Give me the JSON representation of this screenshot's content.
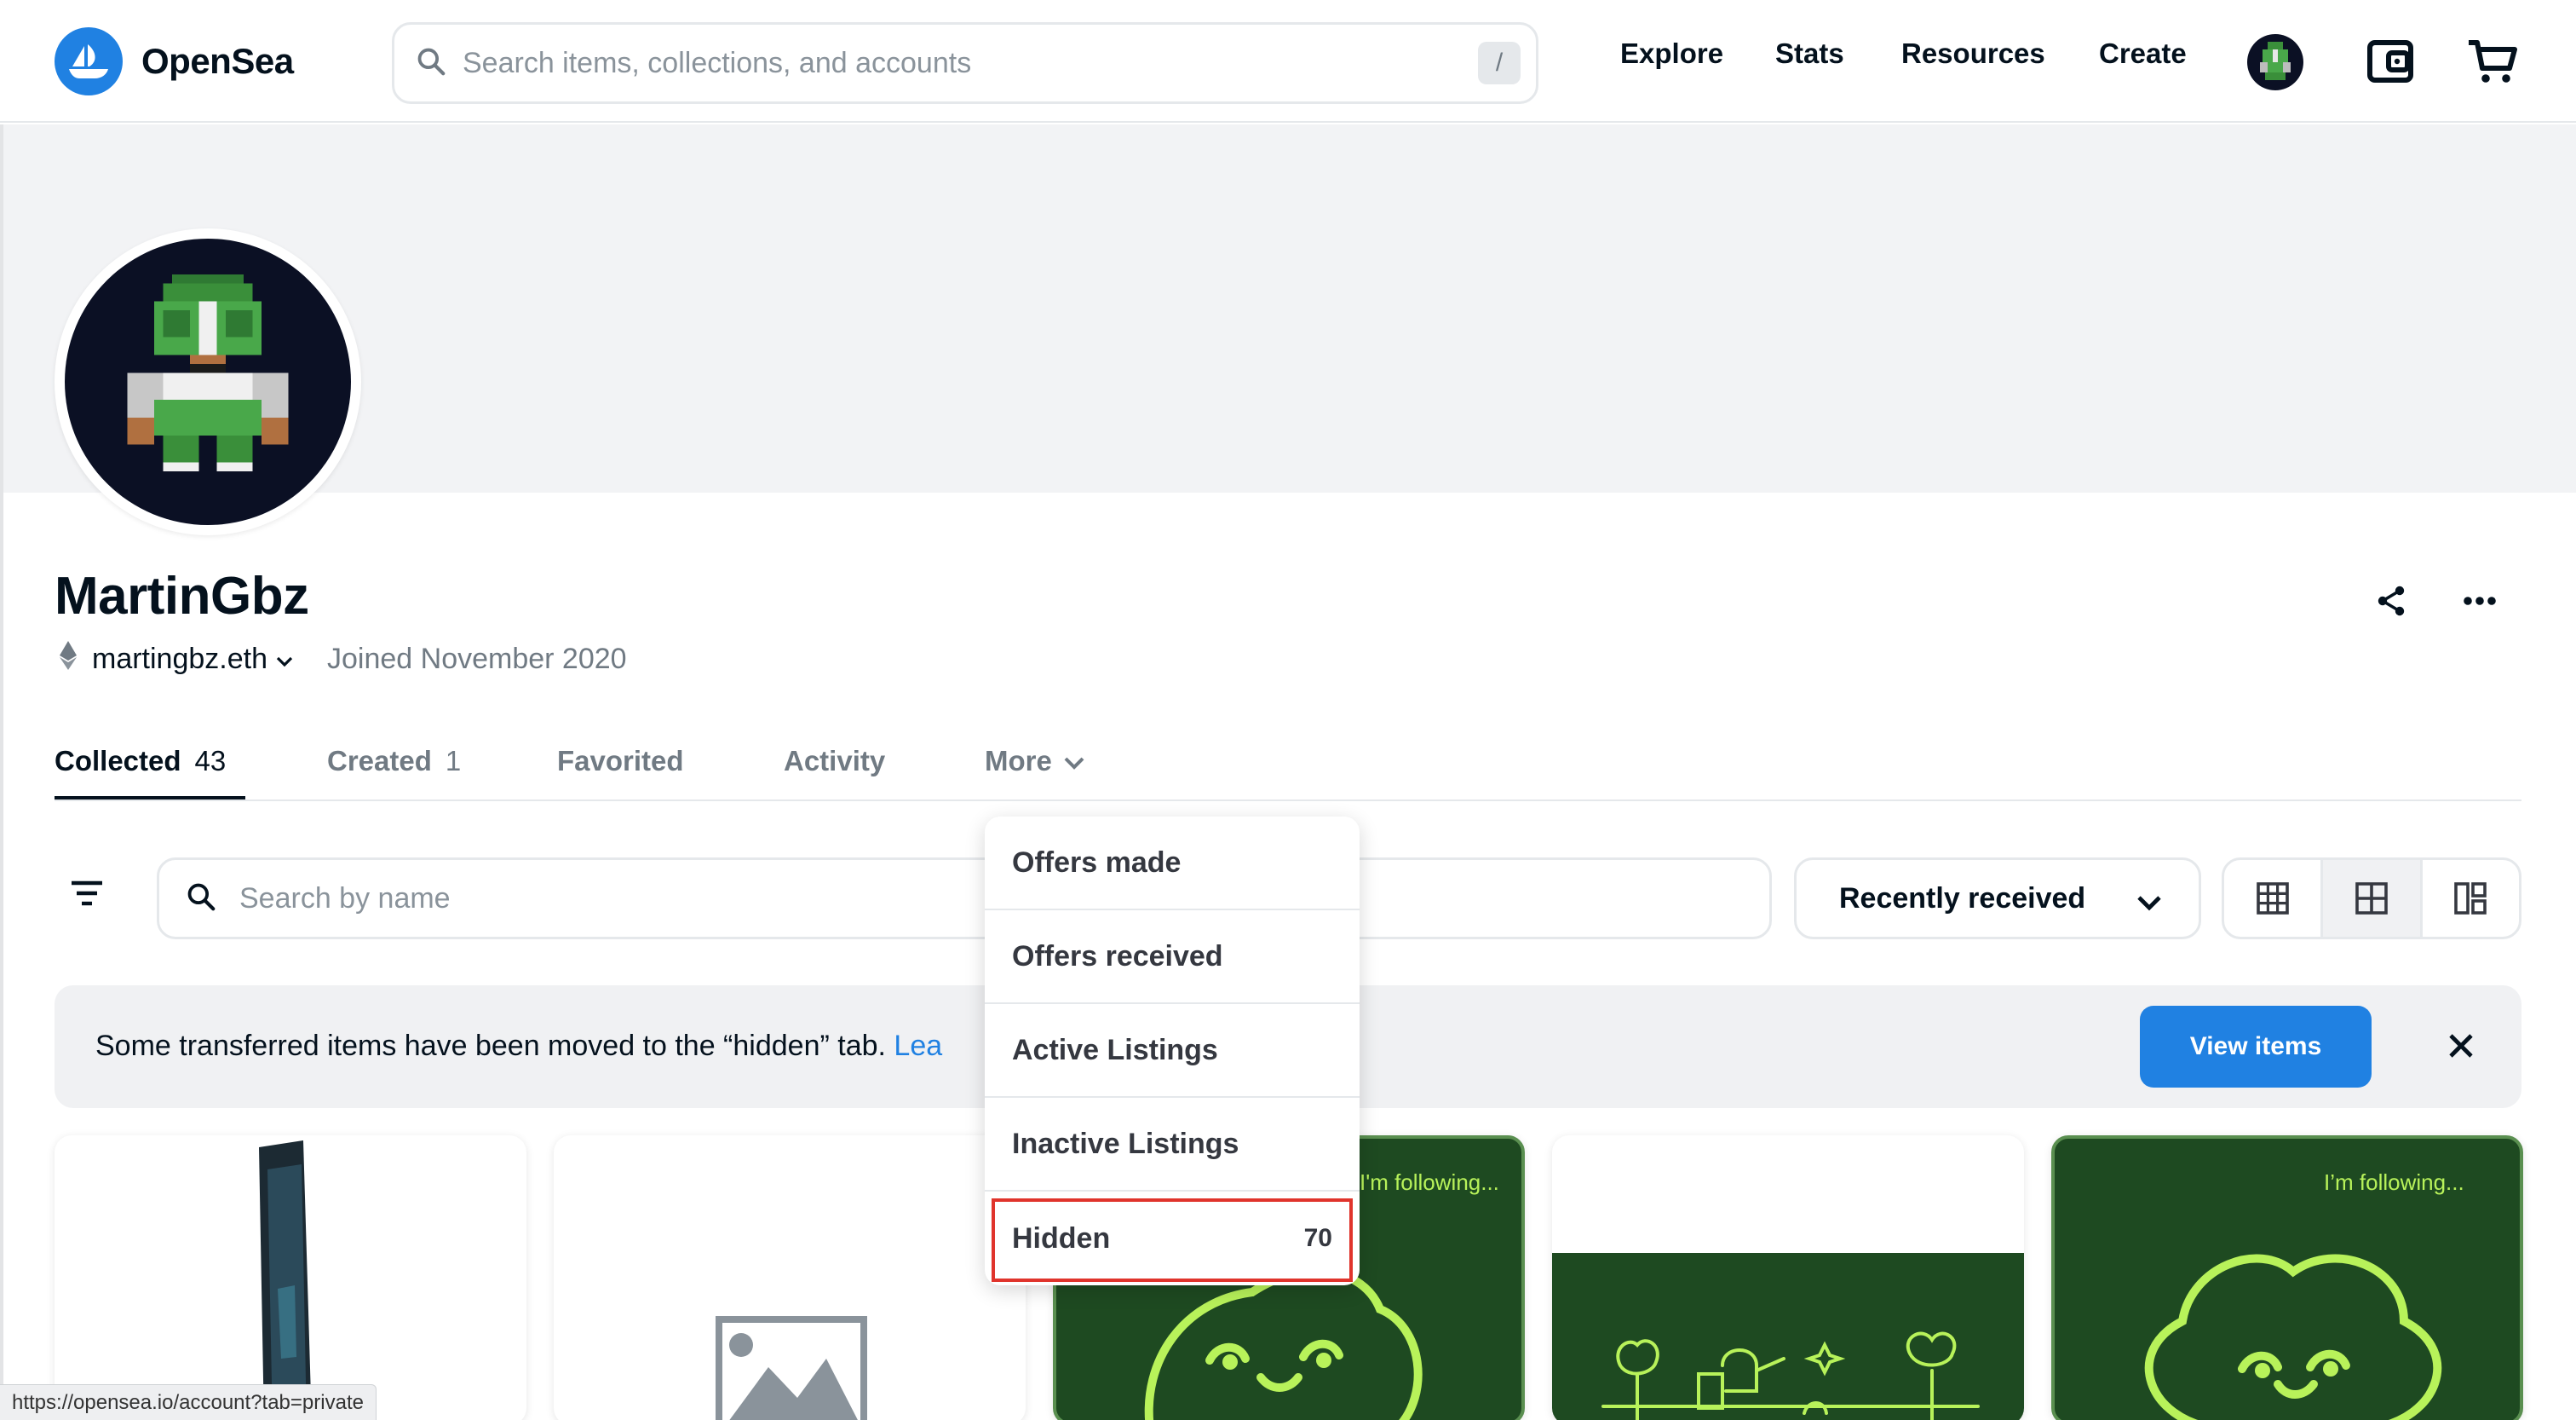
{
  "header": {
    "brand": "OpenSea",
    "search_placeholder": "Search items, collections, and accounts",
    "search_shortcut": "/",
    "nav": [
      "Explore",
      "Stats",
      "Resources",
      "Create"
    ],
    "icons": [
      "avatar",
      "wallet-icon",
      "cart-icon"
    ]
  },
  "profile": {
    "name": "MartinGbz",
    "address": "martingbz.eth",
    "joined": "Joined November 2020"
  },
  "tabs": [
    {
      "label": "Collected",
      "count": "43",
      "active": true
    },
    {
      "label": "Created",
      "count": "1"
    },
    {
      "label": "Favorited",
      "count": ""
    },
    {
      "label": "Activity",
      "count": ""
    },
    {
      "label": "More",
      "count": ""
    }
  ],
  "toolbar": {
    "search_placeholder": "Search by name",
    "sort_label": "Recently received"
  },
  "notice": {
    "text": "Some transferred items have been moved to the “hidden” tab.",
    "link": "Lea",
    "button": "View items"
  },
  "more_menu": {
    "items": [
      {
        "label": "Offers made",
        "count": ""
      },
      {
        "label": "Offers received",
        "count": ""
      },
      {
        "label": "Active Listings",
        "count": ""
      },
      {
        "label": "Inactive Listings",
        "count": ""
      },
      {
        "label": "Hidden",
        "count": "70",
        "highlighted": true
      }
    ]
  },
  "cards": {
    "captions": [
      "I'm following...",
      "I’m following..."
    ]
  },
  "status_url": "https://opensea.io/account?tab=private",
  "colors": {
    "accent": "#2081e2",
    "highlight": "#e0342c",
    "card_green": "#1e4a21",
    "card_line": "#b8f25a"
  }
}
